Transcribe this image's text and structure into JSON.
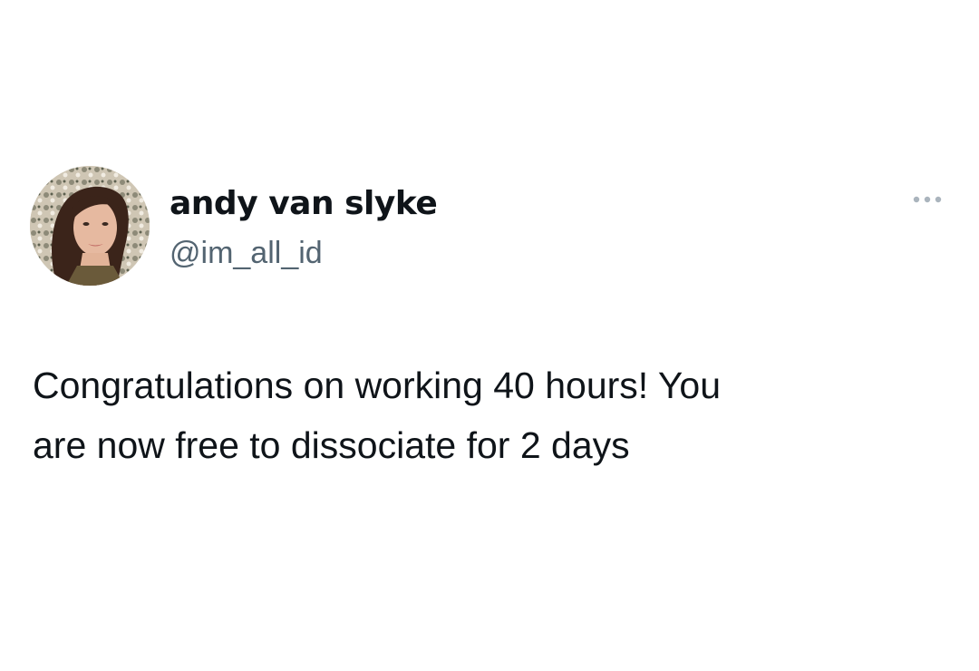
{
  "author": {
    "display_name": "andy van slyke",
    "handle": "@im_all_id",
    "avatar_icon": "profile-photo"
  },
  "more_icon": "more-horizontal-icon",
  "tweet": {
    "lines": [
      "Congratulations on working 40 hours! You",
      "are now free to dissociate for 2 days"
    ]
  },
  "colors": {
    "text_primary": "#0f1419",
    "text_secondary": "#536471",
    "background": "#ffffff"
  }
}
